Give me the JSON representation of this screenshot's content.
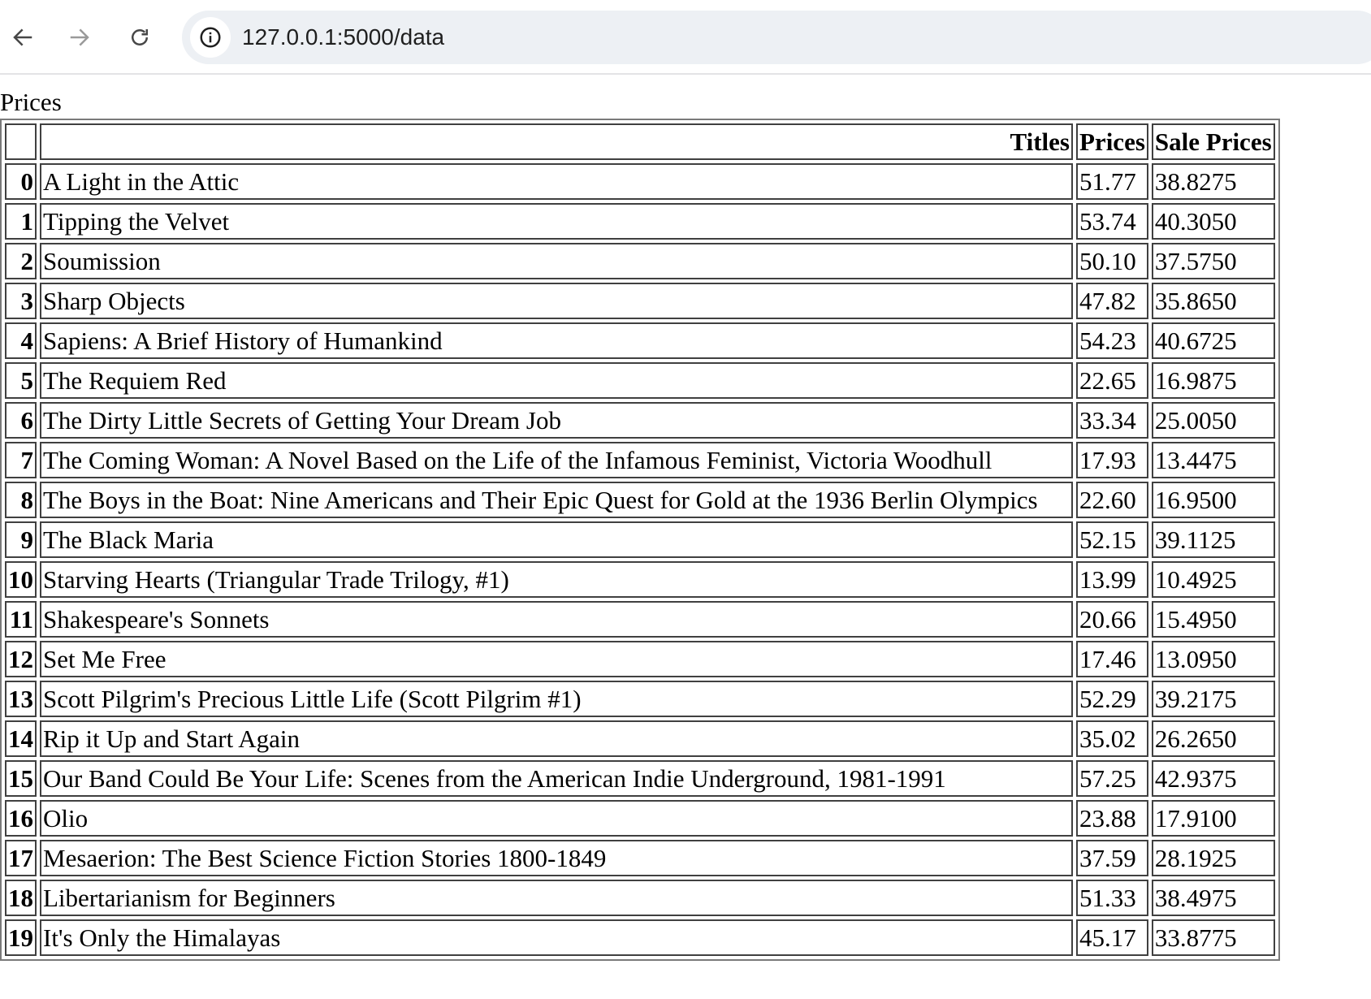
{
  "browser": {
    "url": "127.0.0.1:5000/data",
    "icons": {
      "back": "arrow-left-icon",
      "forward": "arrow-right-icon",
      "reload": "reload-icon",
      "site_info": "info-circle-icon"
    }
  },
  "page": {
    "heading": "Prices",
    "table": {
      "columns": [
        "",
        "Titles",
        "Prices",
        "Sale Prices"
      ],
      "rows": [
        {
          "index": "0",
          "title": "A Light in the Attic",
          "price": "51.77",
          "sale": "38.8275"
        },
        {
          "index": "1",
          "title": "Tipping the Velvet",
          "price": "53.74",
          "sale": "40.3050"
        },
        {
          "index": "2",
          "title": "Soumission",
          "price": "50.10",
          "sale": "37.5750"
        },
        {
          "index": "3",
          "title": "Sharp Objects",
          "price": "47.82",
          "sale": "35.8650"
        },
        {
          "index": "4",
          "title": "Sapiens: A Brief History of Humankind",
          "price": "54.23",
          "sale": "40.6725"
        },
        {
          "index": "5",
          "title": "The Requiem Red",
          "price": "22.65",
          "sale": "16.9875"
        },
        {
          "index": "6",
          "title": "The Dirty Little Secrets of Getting Your Dream Job",
          "price": "33.34",
          "sale": "25.0050"
        },
        {
          "index": "7",
          "title": "The Coming Woman: A Novel Based on the Life of the Infamous Feminist, Victoria Woodhull",
          "price": "17.93",
          "sale": "13.4475"
        },
        {
          "index": "8",
          "title": "The Boys in the Boat: Nine Americans and Their Epic Quest for Gold at the 1936 Berlin Olympics",
          "price": "22.60",
          "sale": "16.9500"
        },
        {
          "index": "9",
          "title": "The Black Maria",
          "price": "52.15",
          "sale": "39.1125"
        },
        {
          "index": "10",
          "title": "Starving Hearts (Triangular Trade Trilogy, #1)",
          "price": "13.99",
          "sale": "10.4925"
        },
        {
          "index": "11",
          "title": "Shakespeare's Sonnets",
          "price": "20.66",
          "sale": "15.4950"
        },
        {
          "index": "12",
          "title": "Set Me Free",
          "price": "17.46",
          "sale": "13.0950"
        },
        {
          "index": "13",
          "title": "Scott Pilgrim's Precious Little Life (Scott Pilgrim #1)",
          "price": "52.29",
          "sale": "39.2175"
        },
        {
          "index": "14",
          "title": "Rip it Up and Start Again",
          "price": "35.02",
          "sale": "26.2650"
        },
        {
          "index": "15",
          "title": "Our Band Could Be Your Life: Scenes from the American Indie Underground, 1981-1991",
          "price": "57.25",
          "sale": "42.9375"
        },
        {
          "index": "16",
          "title": "Olio",
          "price": "23.88",
          "sale": "17.9100"
        },
        {
          "index": "17",
          "title": "Mesaerion: The Best Science Fiction Stories 1800-1849",
          "price": "37.59",
          "sale": "28.1925"
        },
        {
          "index": "18",
          "title": "Libertarianism for Beginners",
          "price": "51.33",
          "sale": "38.4975"
        },
        {
          "index": "19",
          "title": "It's Only the Himalayas",
          "price": "45.17",
          "sale": "33.8775"
        }
      ]
    }
  }
}
